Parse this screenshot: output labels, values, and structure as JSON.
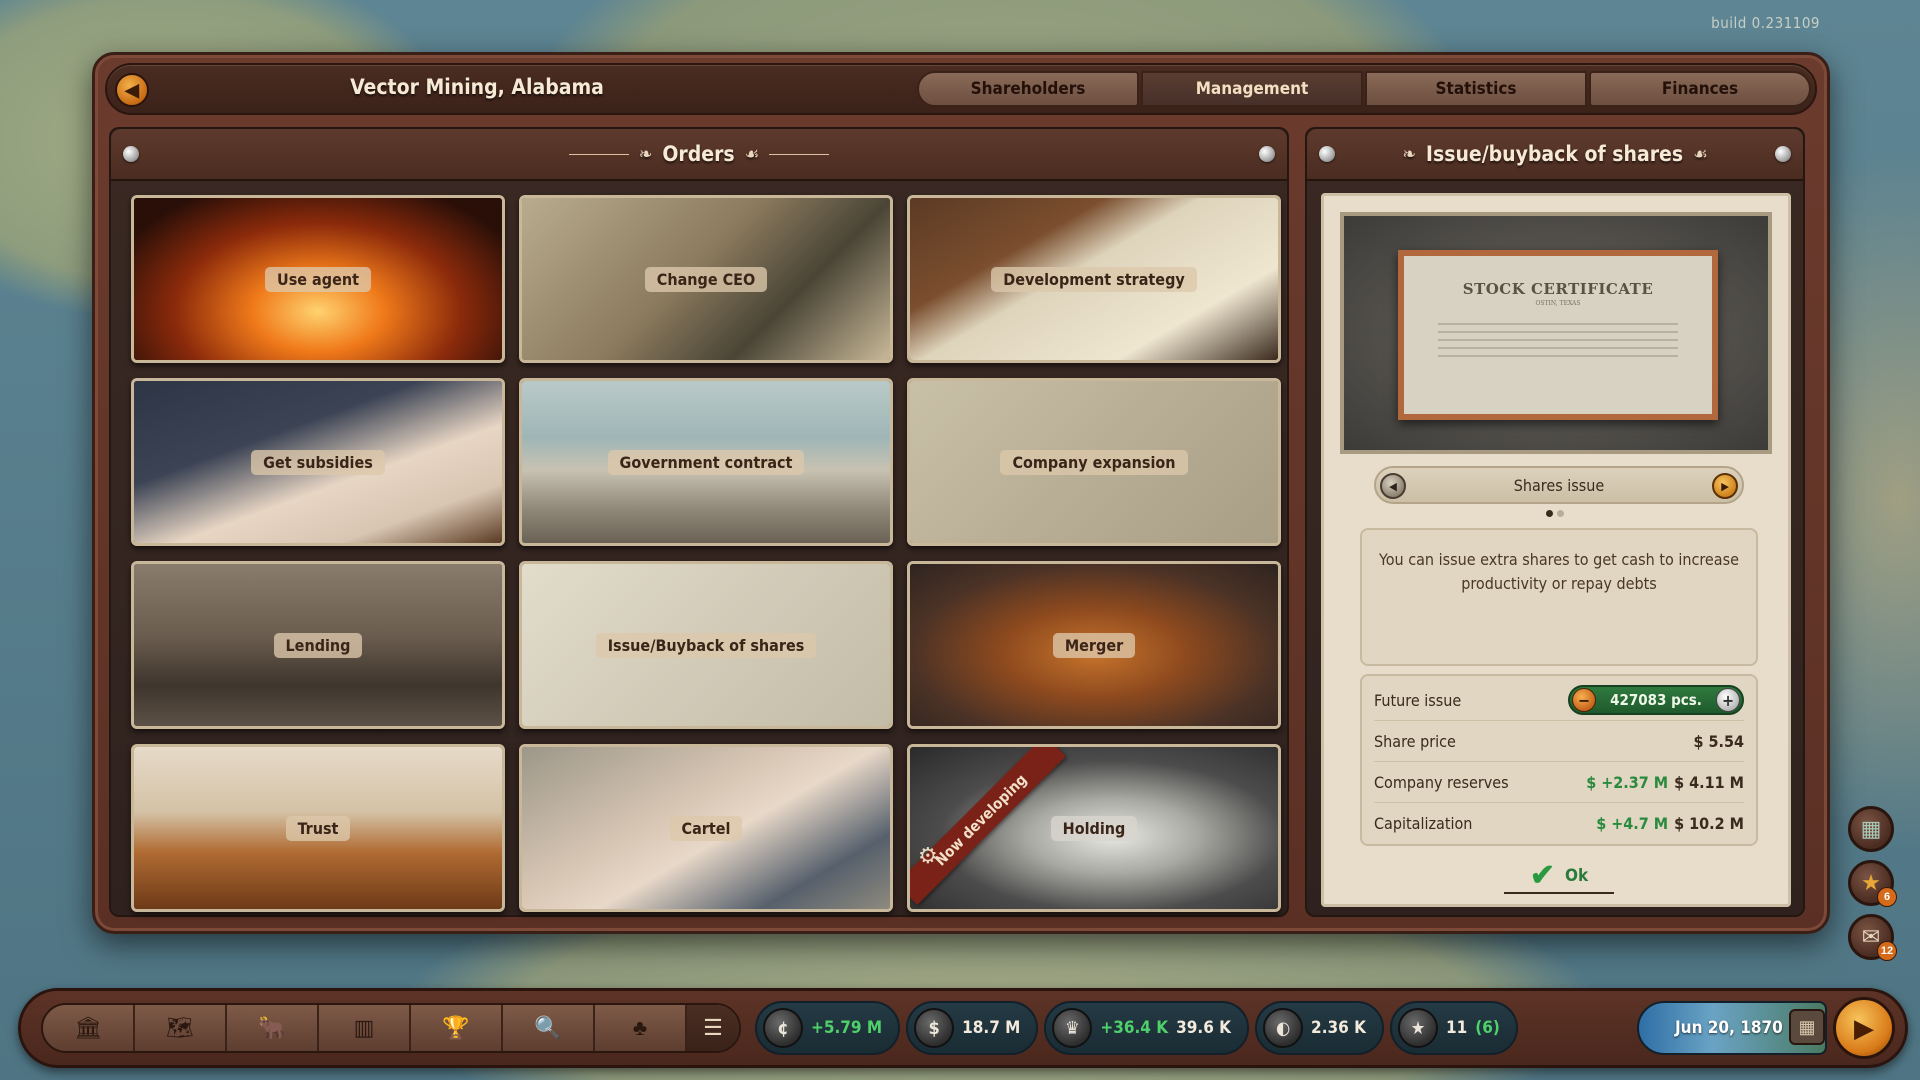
{
  "build": "build 0.231109",
  "header": {
    "company": "Vector Mining, Alabama",
    "back_icon": "back-arrow-icon",
    "tabs": [
      {
        "label": "Shareholders",
        "active": false
      },
      {
        "label": "Management",
        "active": true
      },
      {
        "label": "Statistics",
        "active": false
      },
      {
        "label": "Finances",
        "active": false
      }
    ]
  },
  "orders": {
    "title": "Orders",
    "cards": [
      {
        "label": "Use agent"
      },
      {
        "label": "Change CEO"
      },
      {
        "label": "Development strategy"
      },
      {
        "label": "Get subsidies"
      },
      {
        "label": "Government contract"
      },
      {
        "label": "Company expansion"
      },
      {
        "label": "Lending"
      },
      {
        "label": "Issue/Buyback of shares"
      },
      {
        "label": "Merger"
      },
      {
        "label": "Trust"
      },
      {
        "label": "Cartel"
      },
      {
        "label": "Holding",
        "ribbon": "Now developing"
      }
    ]
  },
  "issue": {
    "title": "Issue/buyback of shares",
    "certificate_title": "STOCK CERTIFICATE",
    "certificate_sub": "OSTIN, TEXAS",
    "selector": "Shares issue",
    "description": "You can issue extra shares to get cash to increase productivity or repay debts",
    "rows": {
      "future_issue": {
        "label": "Future issue",
        "value": "427083 pcs."
      },
      "share_price": {
        "label": "Share price",
        "value": "$ 5.54"
      },
      "company_reserves": {
        "label": "Company reserves",
        "delta": "$ +2.37 M",
        "value": "$ 4.11 M"
      },
      "capitalization": {
        "label": "Capitalization",
        "delta": "$ +4.7 M",
        "value": "$ 10.2 M"
      }
    },
    "ok": "Ok"
  },
  "side": {
    "badges": {
      "favorites": "6",
      "mail": "12"
    }
  },
  "bottom": {
    "nav_icons": [
      "bank-icon",
      "map-icon",
      "bull-icon",
      "government-icon",
      "trophy-icon",
      "search-icon",
      "tree-icon",
      "menu-icon"
    ],
    "income": "+5.79 M",
    "cash": "18.7 M",
    "prestige_delta": "+36.4 K",
    "prestige": "39.6 K",
    "resource": "2.36 K",
    "stars": "11",
    "stars_extra": "(6)",
    "date": "Jun 20, 1870"
  }
}
